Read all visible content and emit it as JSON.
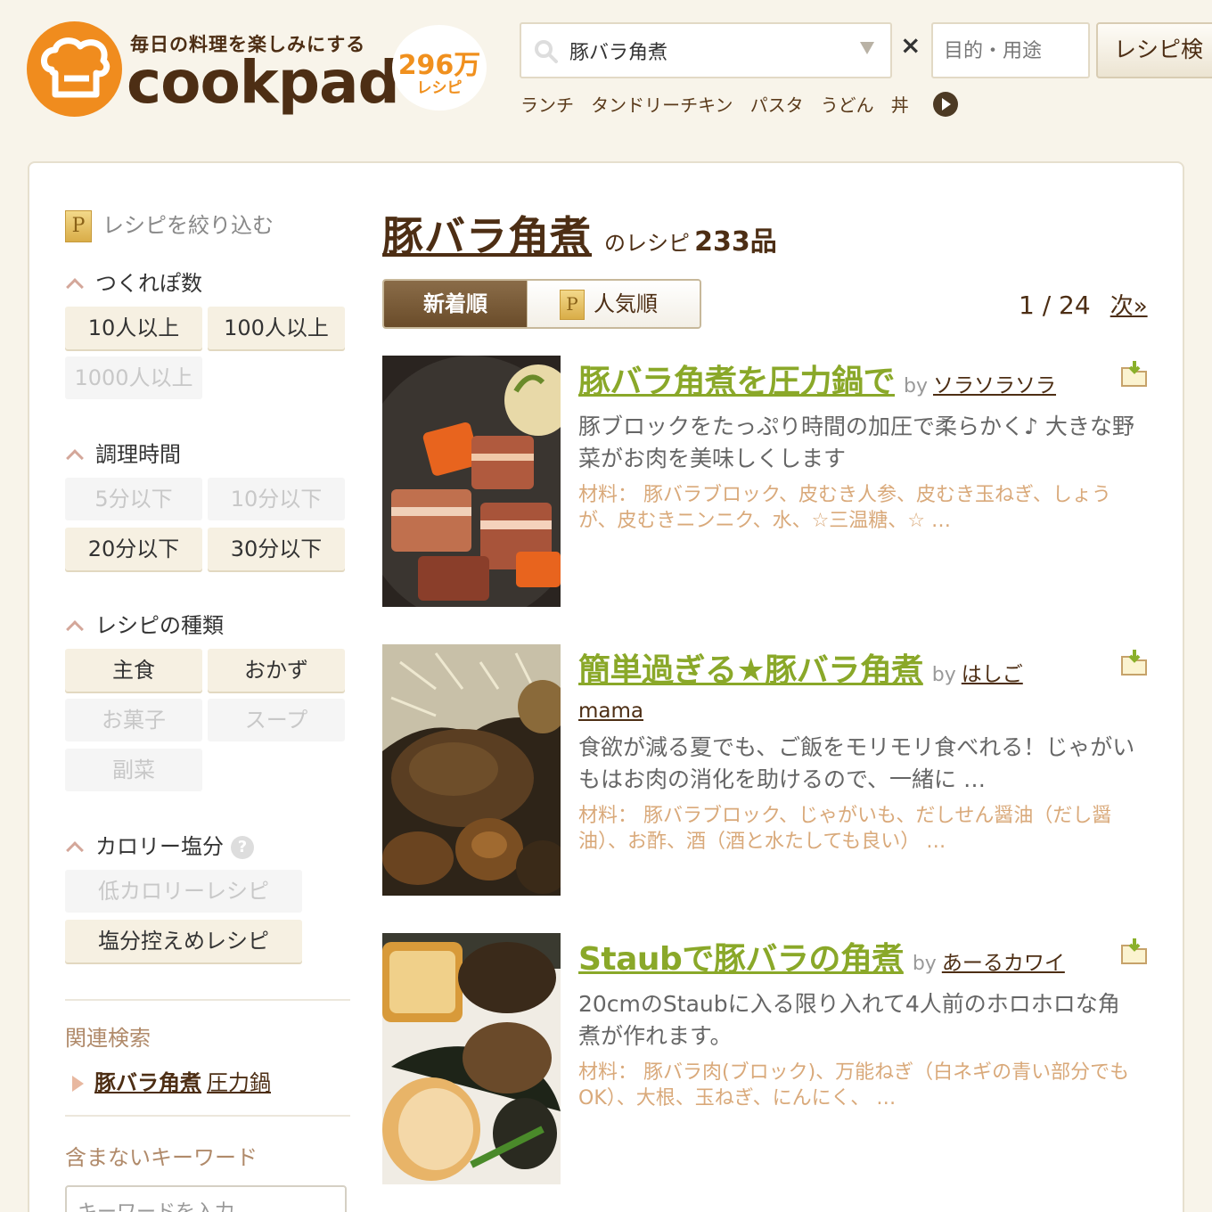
{
  "header": {
    "tagline": "毎日の料理を楽しみにする",
    "brand": "cookpad",
    "recipe_count": "296万",
    "recipe_count_label": "レシピ",
    "search_value": "豚バラ角煮",
    "purpose_placeholder": "目的・用途",
    "search_button": "レシピ検",
    "clear_icon": "×",
    "popular_keywords": [
      "ランチ",
      "タンドリーチキン",
      "パスタ",
      "うどん",
      "丼"
    ]
  },
  "sidebar": {
    "title": "レシピを絞り込む",
    "tsukurepo": {
      "heading": "つくれぽ数",
      "options": [
        "10人以上",
        "100人以上",
        "1000人以上"
      ]
    },
    "cook_time": {
      "heading": "調理時間",
      "options": [
        "5分以下",
        "10分以下",
        "20分以下",
        "30分以下"
      ]
    },
    "recipe_type": {
      "heading": "レシピの種類",
      "options": [
        "主食",
        "おかず",
        "お菓子",
        "スープ",
        "副菜"
      ]
    },
    "calorie_salt": {
      "heading": "カロリー塩分",
      "help": "?",
      "options": [
        "低カロリーレシピ",
        "塩分控えめレシピ"
      ]
    },
    "related": {
      "heading": "関連検索",
      "link_bold": "豚バラ角煮",
      "link_extra": "圧力鍋"
    },
    "exclude": {
      "heading": "含まないキーワード",
      "placeholder": "キーワードを入力"
    }
  },
  "results": {
    "keyword": "豚バラ角煮",
    "suffix": "のレシピ",
    "count": "233品",
    "tab_new": "新着順",
    "tab_popular": "人気順",
    "p_icon": "P",
    "page_current": "1 / 24",
    "page_next": "次»",
    "items": [
      {
        "title": "豚バラ角煮を圧力鍋で",
        "by": "by",
        "author": "ソラソラソラ",
        "author2": "",
        "desc": "豚ブロックをたっぷり時間の加圧で柔らかく♪ 大きな野菜がお肉を美味しくします",
        "ingredients": "材料： 豚バラブロック、皮むき人参、皮むき玉ねぎ、しょうが、皮むきニンニク、水、☆三温糖、☆ …"
      },
      {
        "title": "簡単過ぎる★豚バラ角煮",
        "by": "by",
        "author": "はしご",
        "author2": "mama",
        "desc": "食欲が減る夏でも、ご飯をモリモリ食べれる！じゃがいもはお肉の消化を助けるので、一緒に …",
        "ingredients": "材料： 豚バラブロック、じゃがいも、だしせん醤油（だし醤油）、お酢、酒（酒と水たしても良い） …"
      },
      {
        "title": "Staubで豚バラの角煮",
        "by": "by",
        "author": "あーるカワイ",
        "author2": "",
        "desc": "20cmのStaubに入る限り入れて4人前のホロホロな角煮が作れます。",
        "ingredients": "材料： 豚バラ肉(ブロック)、万能ねぎ（白ネギの青い部分でもOK）、大根、玉ねぎ、にんにく、 …"
      }
    ]
  },
  "colors": {
    "brand_orange": "#f08c1e",
    "brand_brown": "#4d2e14",
    "title_green": "#8aa829",
    "ingredient_tan": "#d9a97a"
  }
}
